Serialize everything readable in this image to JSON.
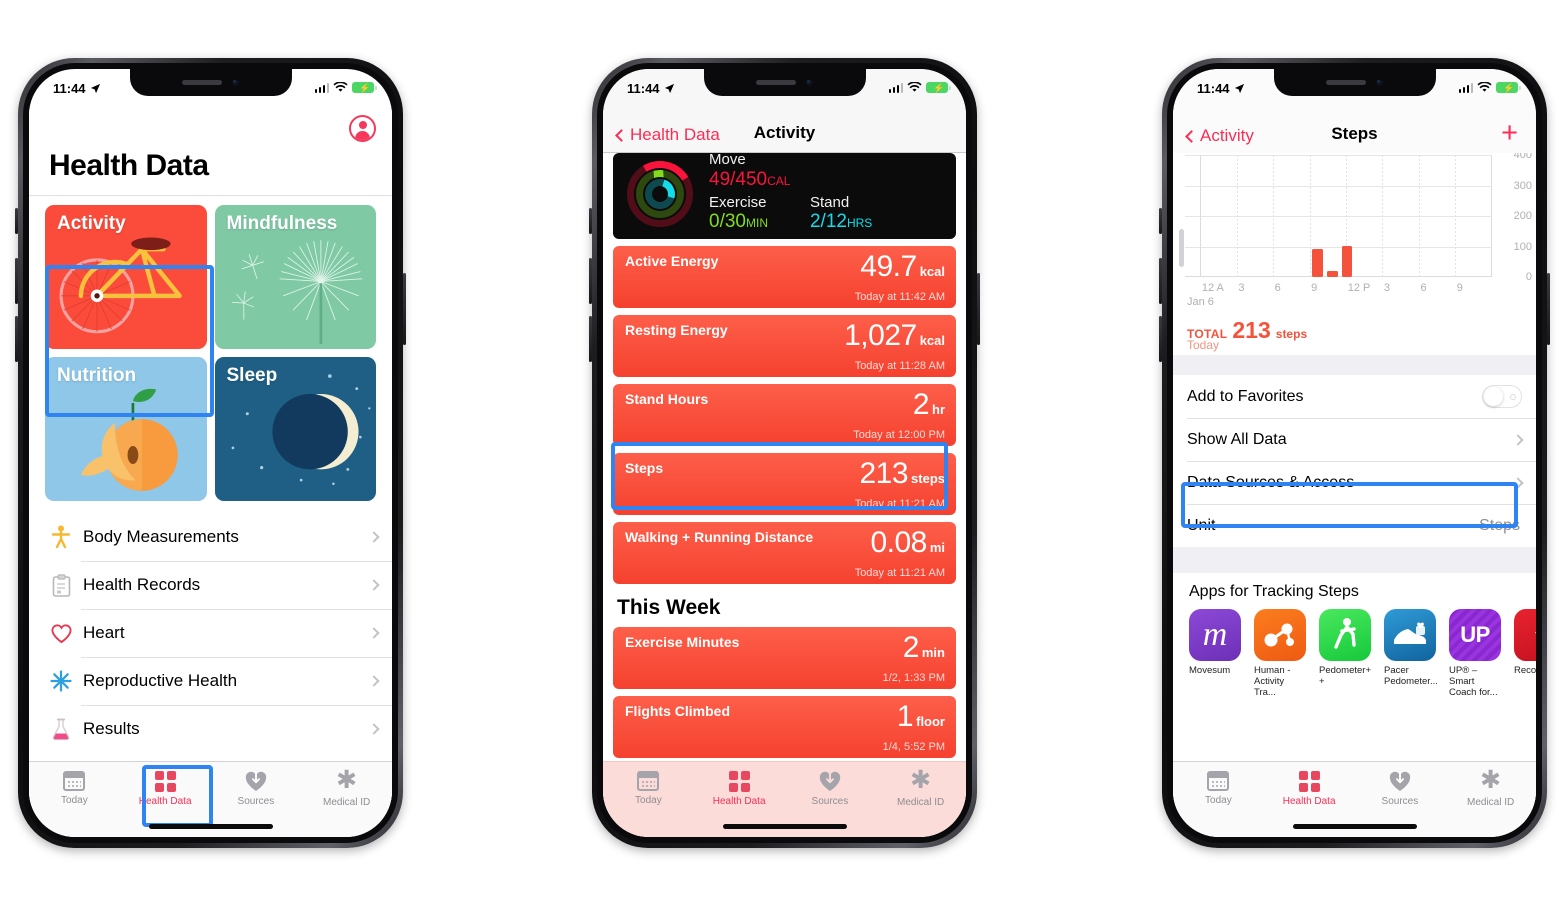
{
  "status_bar": {
    "time": "11:44",
    "location_icon": "location-arrow-icon",
    "wifi_icon": "wifi-icon",
    "battery_icon": "battery-charging-icon"
  },
  "tab_bar": {
    "items": [
      {
        "label": "Today",
        "icon": "calendar-icon",
        "active": false
      },
      {
        "label": "Health Data",
        "icon": "health-grid-icon",
        "active": true
      },
      {
        "label": "Sources",
        "icon": "heart-download-icon",
        "active": false
      },
      {
        "label": "Medical ID",
        "icon": "asterisk-icon",
        "active": false
      }
    ]
  },
  "phone1": {
    "page_title": "Health Data",
    "profile_icon": "profile-avatar-icon",
    "tiles": [
      {
        "label": "Activity",
        "color": "#fb4b3b",
        "art": "bicycle-illustration",
        "highlighted": true
      },
      {
        "label": "Mindfulness",
        "color": "#7fc9a5",
        "art": "dandelion-illustration",
        "highlighted": false
      },
      {
        "label": "Nutrition",
        "color": "#8fc7e8",
        "art": "peach-illustration",
        "highlighted": false
      },
      {
        "label": "Sleep",
        "color": "#1f5f86",
        "art": "moon-stars-illustration",
        "highlighted": false
      }
    ],
    "list_items": [
      {
        "label": "Body Measurements",
        "icon": "body-figure-icon"
      },
      {
        "label": "Health Records",
        "icon": "clipboard-icon"
      },
      {
        "label": "Heart",
        "icon": "heart-outline-icon"
      },
      {
        "label": "Reproductive Health",
        "icon": "snowflake-icon"
      },
      {
        "label": "Results",
        "icon": "flask-icon"
      }
    ]
  },
  "phone2": {
    "nav": {
      "back_label": "Health Data",
      "title": "Activity"
    },
    "rings_card": {
      "move_label": "Move",
      "move_value": "49/450",
      "move_unit": "CAL",
      "exercise_label": "Exercise",
      "exercise_value": "0/30",
      "exercise_unit": "MIN",
      "stand_label": "Stand",
      "stand_value": "2/12",
      "stand_unit": "HRS"
    },
    "today_cards": [
      {
        "title": "Active Energy",
        "value": "49.7",
        "unit": "kcal",
        "timestamp": "Today at 11:42 AM",
        "highlighted": false
      },
      {
        "title": "Resting Energy",
        "value": "1,027",
        "unit": "kcal",
        "timestamp": "Today at 11:28 AM",
        "highlighted": false
      },
      {
        "title": "Stand Hours",
        "value": "2",
        "unit": "hr",
        "timestamp": "Today at 12:00 PM",
        "highlighted": false
      },
      {
        "title": "Steps",
        "value": "213",
        "unit": "steps",
        "timestamp": "Today at 11:21 AM",
        "highlighted": true
      },
      {
        "title": "Walking + Running Distance",
        "value": "0.08",
        "unit": "mi",
        "timestamp": "Today at 11:21 AM",
        "highlighted": false
      }
    ],
    "section_title": "This Week",
    "week_cards": [
      {
        "title": "Exercise Minutes",
        "value": "2",
        "unit": "min",
        "timestamp": "1/2, 1:33 PM"
      },
      {
        "title": "Flights Climbed",
        "value": "1",
        "unit": "floor",
        "timestamp": "1/4, 5:52 PM"
      }
    ]
  },
  "phone3": {
    "nav": {
      "back_label": "Activity",
      "title": "Steps",
      "add_icon": "plus-icon"
    },
    "total": {
      "label": "TOTAL",
      "value": "213",
      "unit": "steps",
      "subtitle": "Today"
    },
    "settings_rows": [
      {
        "label": "Add to Favorites",
        "control": "toggle-off",
        "value": "",
        "highlighted": false
      },
      {
        "label": "Show All Data",
        "control": "chevron",
        "value": "",
        "highlighted": false
      },
      {
        "label": "Data Sources & Access",
        "control": "chevron",
        "value": "",
        "highlighted": true
      },
      {
        "label": "Unit",
        "control": "value",
        "value": "Steps",
        "highlighted": false
      }
    ],
    "apps_title": "Apps for Tracking Steps",
    "apps": [
      {
        "name": "Movesum",
        "glyph": "m",
        "color": "#7b3fc4"
      },
      {
        "name": "Human - Activity Tra...",
        "glyph": "nodes-icon",
        "color": "#f56a1c"
      },
      {
        "name": "Pedometer+ +",
        "glyph": "walking-icon",
        "color": "#2ed64a"
      },
      {
        "name": "Pacer Pedometer...",
        "glyph": "shoe-icon",
        "color": "#1d7fc0"
      },
      {
        "name": "UP® – Smart Coach for...",
        "glyph": "UP",
        "color": "#8e2bd4"
      },
      {
        "name": "Reco Unde",
        "glyph": "runner-icon",
        "color": "#d91a28"
      }
    ]
  },
  "chart_data": {
    "type": "bar",
    "title": "Steps",
    "xlabel": "",
    "ylabel": "steps",
    "ylim": [
      0,
      400
    ],
    "yticks": [
      0,
      100,
      200,
      300,
      400
    ],
    "ytick_labels": [
      "0",
      "100",
      "200",
      "300",
      "400"
    ],
    "xtick_labels": [
      "12 A",
      "3",
      "6",
      "9",
      "12 P",
      "3",
      "6",
      "9"
    ],
    "day_label": "Jan 6",
    "grid": true,
    "legend": "none",
    "bar_color": "#f4523c",
    "x": [
      "9 AM",
      "10 AM",
      "11 AM"
    ],
    "values": [
      92,
      20,
      101
    ],
    "total": 213,
    "total_label": "TOTAL 213 steps",
    "annotation": "Today"
  }
}
